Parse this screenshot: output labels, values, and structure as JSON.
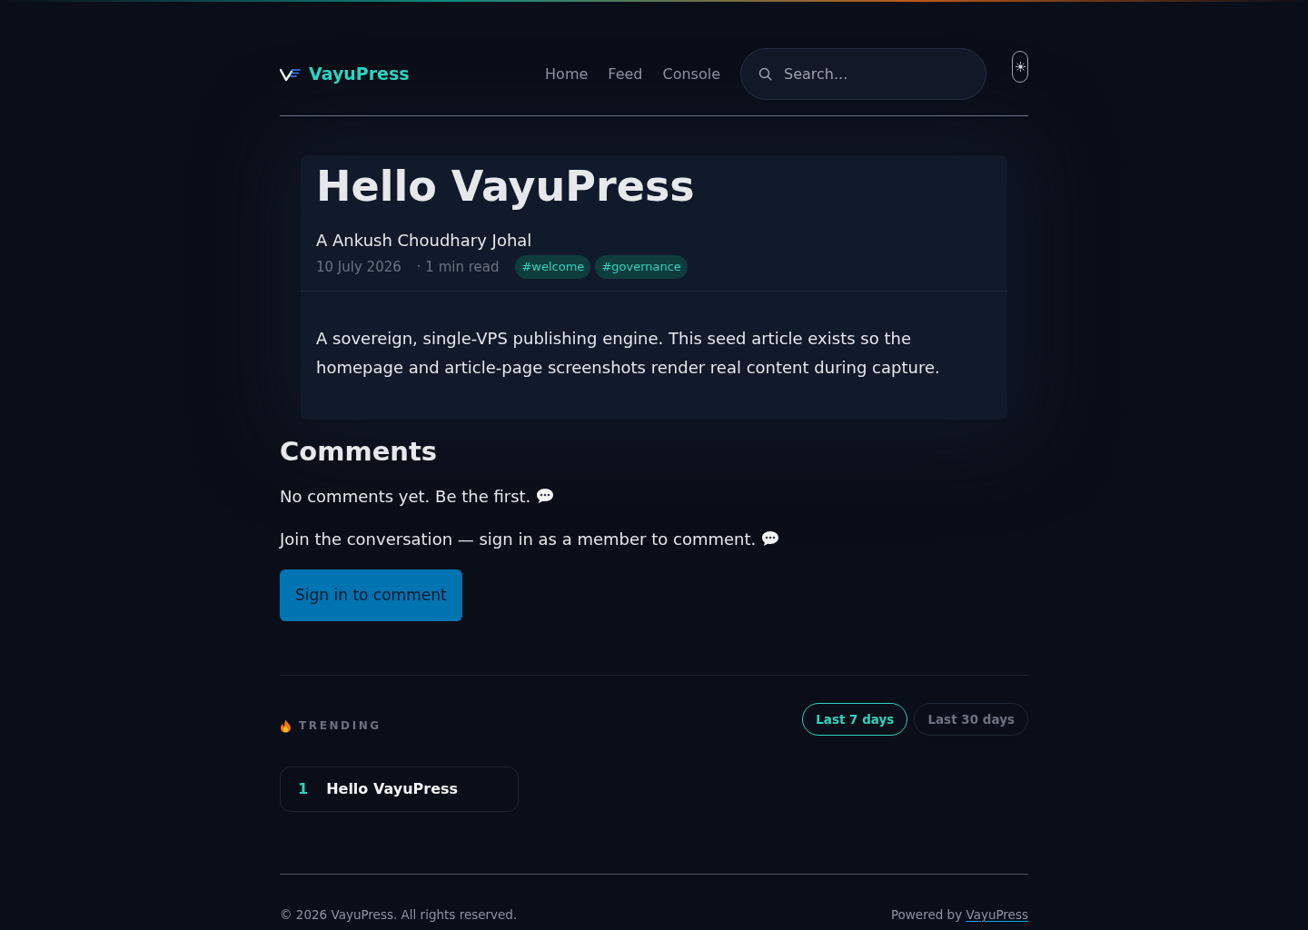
{
  "brand": {
    "name": "VayuPress"
  },
  "nav": [
    {
      "label": "Home"
    },
    {
      "label": "Feed"
    },
    {
      "label": "Console"
    }
  ],
  "search": {
    "placeholder": "Search..."
  },
  "article": {
    "title": "Hello VayuPress",
    "author": "A Ankush Choudhary Johal",
    "date": "10 July 2026",
    "read_time": "· 1 min read",
    "tags": [
      "#welcome",
      "#governance"
    ],
    "body": "A sovereign, single-VPS publishing engine. This seed article exists so the homepage and article-page screenshots render real content during capture."
  },
  "comments": {
    "heading": "Comments",
    "empty_message": "No comments yet. Be the first.",
    "prompt": "Join the conversation — sign in as a member to comment.",
    "button": "Sign in to comment"
  },
  "trending": {
    "heading": "TRENDING",
    "ranges": [
      {
        "label": "Last 7 days",
        "selected": true
      },
      {
        "label": "Last 30 days",
        "selected": false
      }
    ],
    "items": [
      {
        "rank": "1",
        "title": "Hello VayuPress"
      }
    ]
  },
  "footer": {
    "copyright": "© 2026 VayuPress. All rights reserved.",
    "powered_by": "Powered by",
    "link": "VayuPress"
  }
}
